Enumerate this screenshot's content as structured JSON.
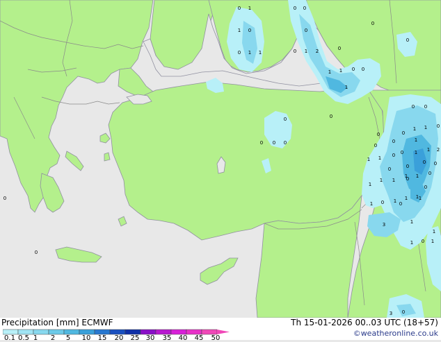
{
  "title": {
    "label": "Precipitation [mm]",
    "model": "ECMWF"
  },
  "valid_time": "Th 15-01-2026 00..03 UTC (18+57)",
  "credit": "©weatheronline.co.uk",
  "legend": {
    "ticks": [
      "0.1",
      "0.5",
      "1",
      "2",
      "5",
      "10",
      "15",
      "20",
      "25",
      "30",
      "35",
      "40",
      "45",
      "50"
    ],
    "colors": [
      "#b8f0f8",
      "#a0e4f4",
      "#88d8ee",
      "#6ccae8",
      "#50b8e0",
      "#3aa0da",
      "#2878d0",
      "#1a50c0",
      "#1030a8",
      "#8a10c8",
      "#b818d0",
      "#d820d8",
      "#e830c8",
      "#f048b8"
    ]
  },
  "map_colors": {
    "sea": "#e8e8e8",
    "land": "#b4f08c",
    "border": "#8a8a8a",
    "coast": "#9090a0"
  },
  "precip_labels": [
    "0",
    "1",
    "1",
    "0",
    "0",
    "1",
    "1",
    "0",
    "0",
    "0",
    "0",
    "1",
    "0",
    "0",
    "2",
    "0",
    "1",
    "1",
    "0",
    "0",
    "1",
    "0",
    "0",
    "0",
    "0",
    "0",
    "0",
    "0",
    "0",
    "0",
    "0",
    "0",
    "1",
    "1",
    "0",
    "1",
    "1",
    "0",
    "1",
    "1",
    "2",
    "0",
    "1",
    "1",
    "0",
    "1",
    "1",
    "0",
    "1",
    "0",
    "1",
    "1",
    "1",
    "1",
    "0",
    "0",
    "1",
    "3",
    "1",
    "1",
    "1",
    "0",
    "1",
    "3",
    "0",
    "0",
    "1",
    "0",
    "0",
    "0",
    "0",
    "0"
  ]
}
